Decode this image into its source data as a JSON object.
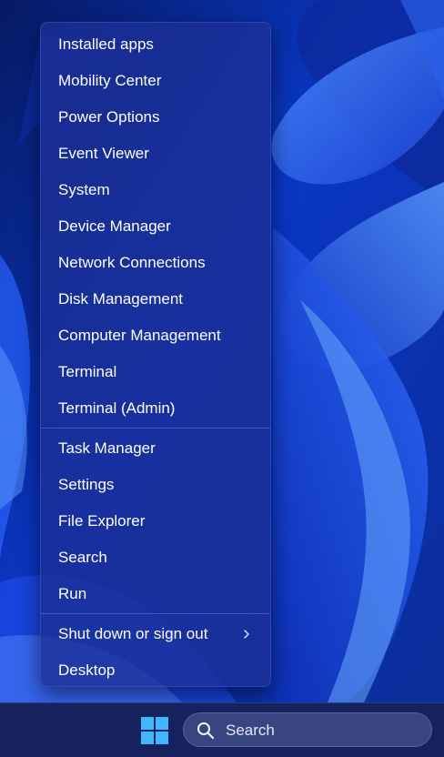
{
  "context_menu": {
    "groups": [
      {
        "items": [
          {
            "label": "Installed apps"
          },
          {
            "label": "Mobility Center"
          },
          {
            "label": "Power Options"
          },
          {
            "label": "Event Viewer"
          },
          {
            "label": "System"
          },
          {
            "label": "Device Manager"
          },
          {
            "label": "Network Connections"
          },
          {
            "label": "Disk Management"
          },
          {
            "label": "Computer Management"
          },
          {
            "label": "Terminal"
          },
          {
            "label": "Terminal (Admin)"
          }
        ]
      },
      {
        "items": [
          {
            "label": "Task Manager"
          },
          {
            "label": "Settings"
          },
          {
            "label": "File Explorer"
          },
          {
            "label": "Search"
          },
          {
            "label": "Run"
          }
        ]
      },
      {
        "items": [
          {
            "label": "Shut down or sign out",
            "submenu": true,
            "submenu_icon": "chevron-right-icon"
          },
          {
            "label": "Desktop"
          }
        ]
      }
    ]
  },
  "taskbar": {
    "start_icon": "windows-logo-icon",
    "search_icon": "search-icon",
    "search_label": "Search"
  },
  "colors": {
    "accent": "#1f6bff",
    "windows_logo": "#3fb6ff",
    "menu_text": "#ffffff"
  }
}
